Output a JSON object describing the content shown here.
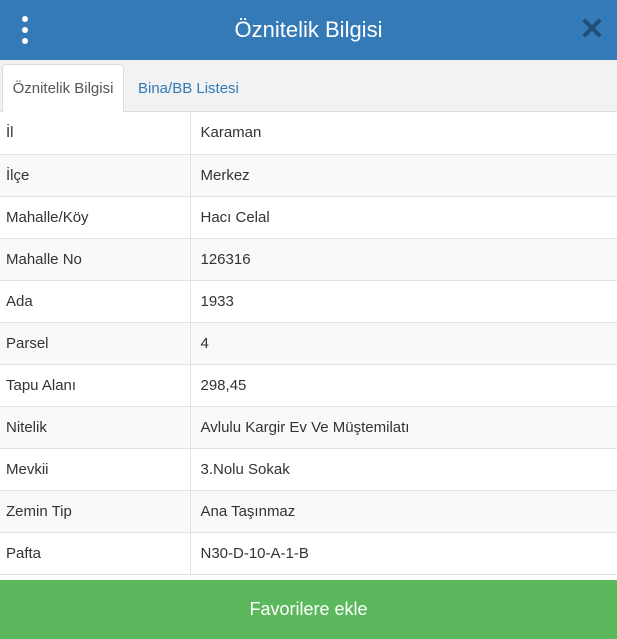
{
  "header": {
    "title": "Öznitelik Bilgisi",
    "menu_icon": "kebab-menu-icon",
    "close_icon": "close-icon"
  },
  "tabs": [
    {
      "label": "Öznitelik Bilgisi",
      "active": true
    },
    {
      "label": "Bina/BB Listesi",
      "active": false
    }
  ],
  "rows": [
    {
      "key": "İl",
      "value": "Karaman"
    },
    {
      "key": "İlçe",
      "value": "Merkez"
    },
    {
      "key": "Mahalle/Köy",
      "value": "Hacı Celal"
    },
    {
      "key": "Mahalle No",
      "value": "126316"
    },
    {
      "key": "Ada",
      "value": "1933"
    },
    {
      "key": "Parsel",
      "value": "4"
    },
    {
      "key": "Tapu Alanı",
      "value": "298,45"
    },
    {
      "key": "Nitelik",
      "value": "Avlulu Kargir Ev Ve Müştemilatı"
    },
    {
      "key": "Mevkii",
      "value": "3.Nolu Sokak"
    },
    {
      "key": "Zemin Tip",
      "value": "Ana Taşınmaz"
    },
    {
      "key": "Pafta",
      "value": "N30-D-10-A-1-B"
    }
  ],
  "footer": {
    "button_label": "Favorilere ekle"
  },
  "colors": {
    "header": "#337ab7",
    "footer": "#5cb85c",
    "tab_link": "#337ab7"
  }
}
